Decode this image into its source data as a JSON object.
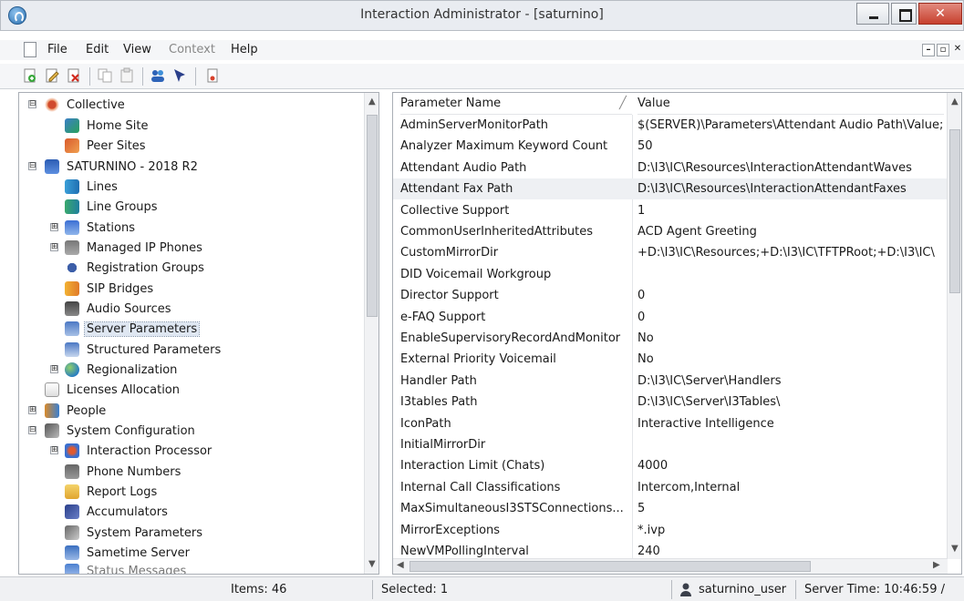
{
  "window": {
    "title": "Interaction Administrator - [saturnino]"
  },
  "menu": {
    "items": [
      {
        "label": "File",
        "disabled": false
      },
      {
        "label": "Edit",
        "disabled": false
      },
      {
        "label": "View",
        "disabled": false
      },
      {
        "label": "Context",
        "disabled": true
      },
      {
        "label": "Help",
        "disabled": false
      }
    ]
  },
  "tree": {
    "items": [
      {
        "label": "Collective",
        "icon": "collective-icon",
        "expander": "⊟"
      },
      {
        "label": "Home Site",
        "icon": "home-site-icon"
      },
      {
        "label": "Peer Sites",
        "icon": "peer-sites-icon"
      },
      {
        "label": "SATURNINO - 2018 R2",
        "icon": "server-icon",
        "expander": "⊟"
      },
      {
        "label": "Lines",
        "icon": "lines-icon"
      },
      {
        "label": "Line Groups",
        "icon": "line-groups-icon"
      },
      {
        "label": "Stations",
        "icon": "stations-icon",
        "expander": "⊞"
      },
      {
        "label": "Managed IP Phones",
        "icon": "ip-phone-icon",
        "expander": "⊞"
      },
      {
        "label": "Registration Groups",
        "icon": "registration-icon"
      },
      {
        "label": "SIP Bridges",
        "icon": "sip-bridge-icon"
      },
      {
        "label": "Audio Sources",
        "icon": "audio-icon"
      },
      {
        "label": "Server Parameters",
        "icon": "server-parameters-icon",
        "selected": true
      },
      {
        "label": "Structured Parameters",
        "icon": "structured-parameters-icon"
      },
      {
        "label": "Regionalization",
        "icon": "globe-icon",
        "expander": "⊞"
      },
      {
        "label": "Licenses Allocation",
        "icon": "license-icon"
      },
      {
        "label": "People",
        "icon": "people-icon",
        "expander": "⊞"
      },
      {
        "label": "System Configuration",
        "icon": "system-config-icon",
        "expander": "⊟"
      },
      {
        "label": "Interaction Processor",
        "icon": "processor-icon",
        "expander": "⊞"
      },
      {
        "label": "Phone Numbers",
        "icon": "phone-numbers-icon"
      },
      {
        "label": "Report Logs",
        "icon": "report-logs-icon"
      },
      {
        "label": "Accumulators",
        "icon": "accumulators-icon"
      },
      {
        "label": "System Parameters",
        "icon": "system-parameters-icon"
      },
      {
        "label": "Sametime Server",
        "icon": "sametime-icon"
      },
      {
        "label": "Status Messages",
        "icon": "status-messages-icon"
      }
    ]
  },
  "list": {
    "columns": {
      "name": "Parameter Name",
      "value": "Value"
    },
    "rows": [
      {
        "name": "AdminServerMonitorPath",
        "value": "$(SERVER)\\Parameters\\Attendant Audio Path\\Value;"
      },
      {
        "name": "Analyzer Maximum Keyword Count",
        "value": "50"
      },
      {
        "name": "Attendant Audio Path",
        "value": "D:\\I3\\IC\\Resources\\InteractionAttendantWaves"
      },
      {
        "name": "Attendant Fax Path",
        "value": "D:\\I3\\IC\\Resources\\InteractionAttendantFaxes",
        "selected": true
      },
      {
        "name": "Collective Support",
        "value": "1"
      },
      {
        "name": "CommonUserInheritedAttributes",
        "value": "ACD Agent Greeting"
      },
      {
        "name": "CustomMirrorDir",
        "value": "+D:\\I3\\IC\\Resources;+D:\\I3\\IC\\TFTPRoot;+D:\\I3\\IC\\"
      },
      {
        "name": "DID Voicemail Workgroup",
        "value": ""
      },
      {
        "name": "Director Support",
        "value": "0"
      },
      {
        "name": "e-FAQ Support",
        "value": "0"
      },
      {
        "name": "EnableSupervisoryRecordAndMonitor",
        "value": "No"
      },
      {
        "name": "External Priority Voicemail",
        "value": "No"
      },
      {
        "name": "Handler Path",
        "value": "D:\\I3\\IC\\Server\\Handlers"
      },
      {
        "name": "I3tables Path",
        "value": "D:\\I3\\IC\\Server\\I3Tables\\"
      },
      {
        "name": "IconPath",
        "value": "Interactive Intelligence"
      },
      {
        "name": "InitialMirrorDir",
        "value": ""
      },
      {
        "name": "Interaction Limit (Chats)",
        "value": "4000"
      },
      {
        "name": "Internal Call Classifications",
        "value": "Intercom,Internal"
      },
      {
        "name": "MaxSimultaneousI3STSConnections...",
        "value": "5"
      },
      {
        "name": "MirrorExceptions",
        "value": "*.ivp"
      },
      {
        "name": "NewVMPollingInterval",
        "value": "240"
      }
    ]
  },
  "status": {
    "items": "Items: 46",
    "selected": "Selected: 1",
    "user": "saturnino_user",
    "server_time": "Server Time: 10:46:59 /"
  }
}
